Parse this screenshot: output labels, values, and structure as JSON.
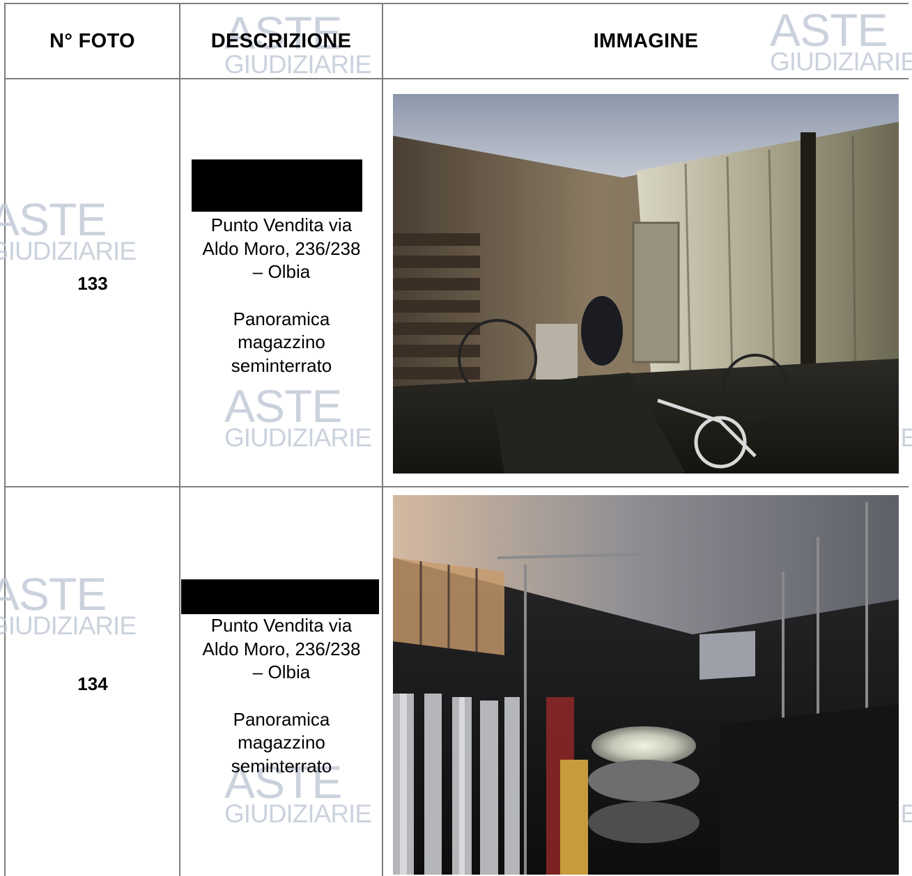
{
  "table": {
    "headers": {
      "num": "N° FOTO",
      "desc": "DESCRIZIONE",
      "img": "IMMAGINE"
    },
    "rows": [
      {
        "number": "133",
        "desc_line1": "Punto Vendita via",
        "desc_line2": "Aldo Moro, 236/238",
        "desc_line3": "– Olbia",
        "desc_line4": "Panoramica",
        "desc_line5": "magazzino",
        "desc_line6": "seminterrato"
      },
      {
        "number": "134",
        "desc_line1": "Punto Vendita via",
        "desc_line2": "Aldo Moro, 236/238",
        "desc_line3": "– Olbia",
        "desc_line4": "Panoramica",
        "desc_line5": "magazzino",
        "desc_line6": "seminterrato"
      }
    ]
  },
  "watermark": {
    "line1": "ASTE",
    "line2": "GIUDIZIARIE",
    "mark": "®",
    "color": "#c2cbd8"
  }
}
